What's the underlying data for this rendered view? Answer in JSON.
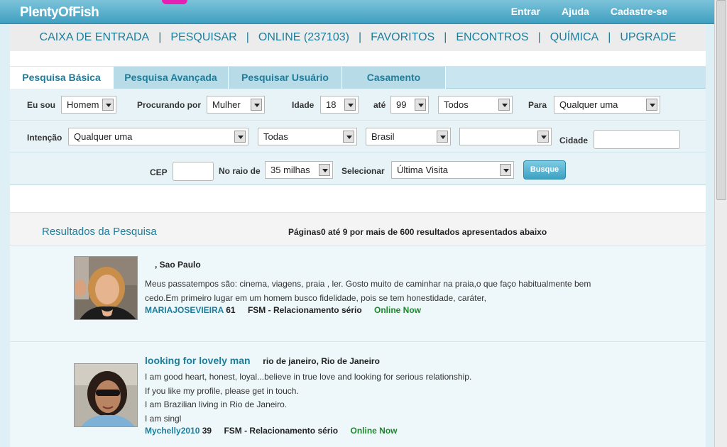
{
  "brand": {
    "logo": "PlentyOfFish"
  },
  "top_links": {
    "enter": "Entrar",
    "help": "Ajuda",
    "signup": "Cadastre-se"
  },
  "main_nav": [
    "CAIXA DE ENTRADA",
    "PESQUISAR",
    "ONLINE (237103)",
    "FAVORITOS",
    "ENCONTROS",
    "QUÍMICA",
    "UPGRADE"
  ],
  "tabs": [
    "Pesquisa Básica",
    "Pesquisa Avançada",
    "Pesquisar Usuário",
    "Casamento"
  ],
  "form": {
    "i_am_label": "Eu sou",
    "i_am_value": "Homem",
    "seeking_label": "Procurando por",
    "seeking_value": "Mulher",
    "age_label": "Idade",
    "age_min": "18",
    "to_label": "até",
    "age_max": "99",
    "ethnicity_value": "Todos",
    "for_label": "Para",
    "for_value": "Qualquer uma",
    "intent_label": "Intenção",
    "intent_value": "Qualquer uma",
    "state_value": "Todas",
    "country_value": "Brasil",
    "extra_value": "",
    "city_label": "Cidade",
    "city_value": "",
    "zip_label": "CEP",
    "zip_value": "",
    "radius_label": "No raio de",
    "radius_value": "35 milhas",
    "sort_label": "Selecionar",
    "sort_value": "Última Visita",
    "search_button": "Busque"
  },
  "results": {
    "title": "Resultados da Pesquisa",
    "summary": "Páginas0 até 9 por mais de 600 resultados apresentados abaixo",
    "items": [
      {
        "headline": "",
        "location": ", Sao Paulo",
        "lines": [
          "Meus passatempos são: cinema, viagens, praia , ler. Gosto muito de caminhar na praia,o que faço habitualmente bem",
          "cedo.Em primeiro lugar em um homem busco fidelidade, pois se tem honestidade, caráter,"
        ],
        "username": "MARIAJOSEVIEIRA",
        "age": "61",
        "intent": "FSM - Relacionamento sério",
        "status": "Online Now"
      },
      {
        "headline": "looking for lovely man",
        "location": "rio de janeiro, Rio de Janeiro",
        "lines": [
          "I am good heart, honest, loyal...believe in true love and looking for serious relationship.",
          "If you like my profile, please get in touch.",
          "I am Brazilian living in Rio de Janeiro.",
          "I am singl"
        ],
        "username": "Mychelly2010",
        "age": "39",
        "intent": "FSM - Relacionamento sério",
        "status": "Online Now"
      }
    ]
  }
}
